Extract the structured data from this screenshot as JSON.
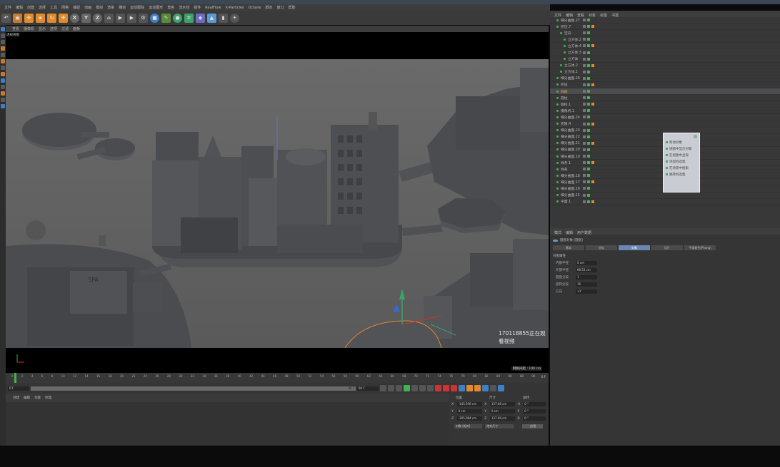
{
  "title_bar": {
    "accent_color": "#3b4754"
  },
  "menu": {
    "items": [
      "文件",
      "编辑",
      "创建",
      "选择",
      "工具",
      "网格",
      "捕捉",
      "动画",
      "模拟",
      "渲染",
      "雕刻",
      "运动跟踪",
      "运动图形",
      "角色",
      "流水线",
      "插件",
      "RealFlow",
      "X-Particles",
      "Octane",
      "脚本",
      "窗口",
      "帮助"
    ]
  },
  "toolbar": {
    "axis_x": "X",
    "axis_y": "Y",
    "axis_z": "Z"
  },
  "viewport": {
    "menu": [
      "查看",
      "摄像机",
      "显示",
      "选项",
      "过滤",
      "面板"
    ],
    "label": "透视视图",
    "grid_spacing": "网格间距 : 100 cm",
    "watermark": "170118855正在观看视频"
  },
  "timeline": {
    "ticks": [
      "0",
      "2",
      "4",
      "6",
      "8",
      "10",
      "12",
      "14",
      "16",
      "18",
      "20",
      "22",
      "24",
      "26",
      "28",
      "30",
      "32",
      "34",
      "36",
      "38",
      "40",
      "42",
      "44",
      "46",
      "48",
      "50",
      "52",
      "54",
      "56",
      "58",
      "60",
      "62",
      "64",
      "66",
      "68",
      "70",
      "72",
      "74",
      "76",
      "78",
      "80",
      "82",
      "84",
      "86",
      "88",
      "90"
    ],
    "end_frame": "0 F",
    "start_field": "0 F",
    "current_field": "90 F",
    "end_field": "90 F"
  },
  "material_manager": {
    "menu": [
      "创建",
      "编辑",
      "功能",
      "纹理"
    ]
  },
  "coordinates": {
    "headers": [
      "位置",
      "尺寸",
      "旋转"
    ],
    "rows": [
      {
        "axis": "X",
        "pos": "-145.506 cm",
        "size": "137.06 cm",
        "rot_label": "H",
        "rot": "0 °"
      },
      {
        "axis": "Y",
        "pos": "0 cm",
        "size": "0 cm",
        "rot_label": "P",
        "rot": "0 °"
      },
      {
        "axis": "Z",
        "pos": "-205.084 cm",
        "size": "137.06 cm",
        "rot_label": "B",
        "rot": "0 °"
      }
    ],
    "mode_select": "对象 (相对)",
    "size_select": "绝对尺寸",
    "apply_button": "应用"
  },
  "object_manager": {
    "tabs": [
      "文件",
      "编辑",
      "查看",
      "对象",
      "标签",
      "书签"
    ],
    "objects": [
      {
        "name": "细分曲面.27",
        "level": 0
      },
      {
        "name": "挤压.7",
        "level": 0
      },
      {
        "name": "空白",
        "level": 1
      },
      {
        "name": "立方体.2",
        "level": 2
      },
      {
        "name": "立方体.4",
        "level": 2
      },
      {
        "name": "立方体.3",
        "level": 2
      },
      {
        "name": "立方体",
        "level": 2
      },
      {
        "name": "立方体.2",
        "level": 1
      },
      {
        "name": "立方体.1",
        "level": 1
      },
      {
        "name": "细分曲面.26",
        "level": 0
      },
      {
        "name": "挤压",
        "level": 0
      },
      {
        "name": "圆盘",
        "level": 0,
        "selected": true
      },
      {
        "name": "圆柱",
        "level": 0
      },
      {
        "name": "圆柱.1",
        "level": 0
      },
      {
        "name": "摄像机.1",
        "level": 0
      },
      {
        "name": "细分曲面.24",
        "level": 0
      },
      {
        "name": "克隆.4",
        "level": 0
      },
      {
        "name": "细分曲面.23",
        "level": 0
      },
      {
        "name": "细分曲面.22",
        "level": 0
      },
      {
        "name": "细分曲面.21",
        "level": 0
      },
      {
        "name": "细分曲面.20",
        "level": 0
      },
      {
        "name": "细分曲面.19",
        "level": 0
      },
      {
        "name": "样条.1",
        "level": 0
      },
      {
        "name": "样条",
        "level": 0
      },
      {
        "name": "细分曲面.18",
        "level": 0
      },
      {
        "name": "细分曲面.17",
        "level": 0
      },
      {
        "name": "细分曲面.16",
        "level": 0
      },
      {
        "name": "细分曲面.15",
        "level": 0
      },
      {
        "name": "平面.1",
        "level": 0
      }
    ]
  },
  "context_popup": {
    "items": [
      "移动对象",
      "视图中显示对象",
      "在视图中呈现",
      "添加到选集",
      "在场景中搜索",
      "跳转到选集"
    ]
  },
  "attributes": {
    "tabs": [
      "模式",
      "编辑",
      "用户数据"
    ],
    "object_title": "圆盘对象 [圆盘]",
    "sub_tabs": [
      "基本",
      "坐标",
      "对象",
      "切片",
      "平滑着色(Phong)"
    ],
    "active_sub_tab": 2,
    "section": "对象属性",
    "fields": [
      {
        "label": "内部半径",
        "value": "0 cm"
      },
      {
        "label": "外部半径",
        "value": "68.53 cm"
      },
      {
        "label": "圆盘分段",
        "value": "1"
      },
      {
        "label": "旋转分段",
        "value": "16"
      },
      {
        "label": "方向",
        "value": "+Y"
      }
    ]
  }
}
